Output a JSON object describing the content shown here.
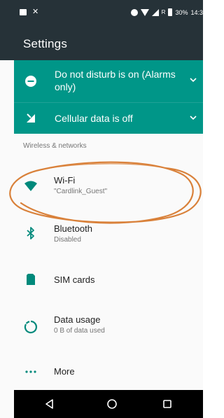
{
  "status_bar": {
    "icons_left": [
      "notification-icon",
      "close-icon"
    ],
    "battery": "30%",
    "time": "14:3"
  },
  "toolbar": {
    "title": "Settings"
  },
  "conditionals": [
    {
      "label": "Do not disturb is on (Alarms only)",
      "icon": "do-not-disturb-icon"
    },
    {
      "label": "Cellular data is off",
      "icon": "cellular-data-off-icon"
    }
  ],
  "section": {
    "header": "Wireless & networks"
  },
  "items": [
    {
      "title": "Wi-Fi",
      "subtitle": "\"Cardlink_Guest\"",
      "icon": "wifi-icon"
    },
    {
      "title": "Bluetooth",
      "subtitle": "Disabled",
      "icon": "bluetooth-icon"
    },
    {
      "title": "SIM cards",
      "icon": "sim-card-icon"
    },
    {
      "title": "Data usage",
      "subtitle": "0 B of data used",
      "icon": "data-usage-icon"
    },
    {
      "title": "More",
      "icon": "more-icon"
    }
  ],
  "nav_bar": {
    "buttons": [
      "back-icon",
      "home-icon",
      "recents-icon"
    ]
  },
  "colors": {
    "status_bar": "#263238",
    "accent": "#009688",
    "annotation": "#d9813a"
  }
}
